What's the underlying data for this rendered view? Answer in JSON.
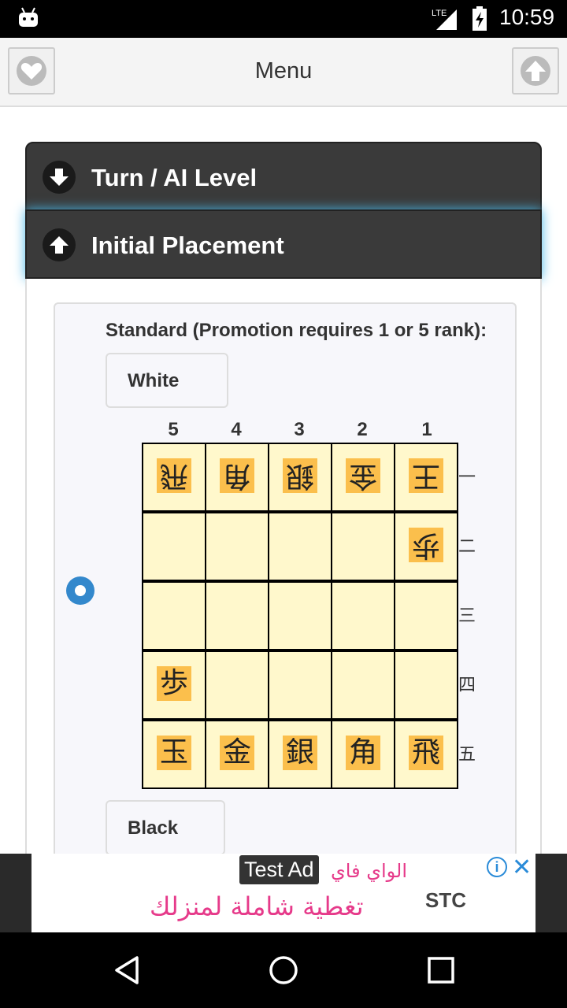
{
  "status_bar": {
    "network": "LTE",
    "time": "10:59"
  },
  "topbar": {
    "title": "Menu",
    "left_icon": "heart-icon",
    "right_icon": "arrow-up-icon"
  },
  "sections": [
    {
      "label": "Turn / AI Level",
      "icon": "arrow-down-icon"
    },
    {
      "label": "Initial Placement",
      "icon": "arrow-up-icon"
    }
  ],
  "placement": {
    "heading": "Standard (Promotion requires 1 or 5 rank):",
    "white_label": "White",
    "black_label": "Black",
    "selected": true,
    "columns": [
      "5",
      "4",
      "3",
      "2",
      "1"
    ],
    "rows": [
      "一",
      "二",
      "三",
      "四",
      "五"
    ],
    "board": [
      [
        {
          "c": "飛",
          "rev": true
        },
        {
          "c": "角",
          "rev": true
        },
        {
          "c": "銀",
          "rev": true
        },
        {
          "c": "金",
          "rev": true
        },
        {
          "c": "王",
          "rev": true
        }
      ],
      [
        null,
        null,
        null,
        null,
        {
          "c": "歩",
          "rev": true
        }
      ],
      [
        null,
        null,
        null,
        null,
        null
      ],
      [
        {
          "c": "歩",
          "rev": false
        },
        null,
        null,
        null,
        null
      ],
      [
        {
          "c": "玉",
          "rev": false
        },
        {
          "c": "金",
          "rev": false
        },
        {
          "c": "銀",
          "rev": false
        },
        {
          "c": "角",
          "rev": false
        },
        {
          "c": "飛",
          "rev": false
        }
      ]
    ]
  },
  "ad": {
    "badge": "Test Ad",
    "line1": "الواي فاي",
    "line2": "تغطية شاملة لمنزلك",
    "brand": "STC",
    "info_icon": "info-icon",
    "close_icon": "close-icon"
  },
  "navbar": {
    "icons": [
      "back-icon",
      "home-icon",
      "recents-icon"
    ]
  }
}
